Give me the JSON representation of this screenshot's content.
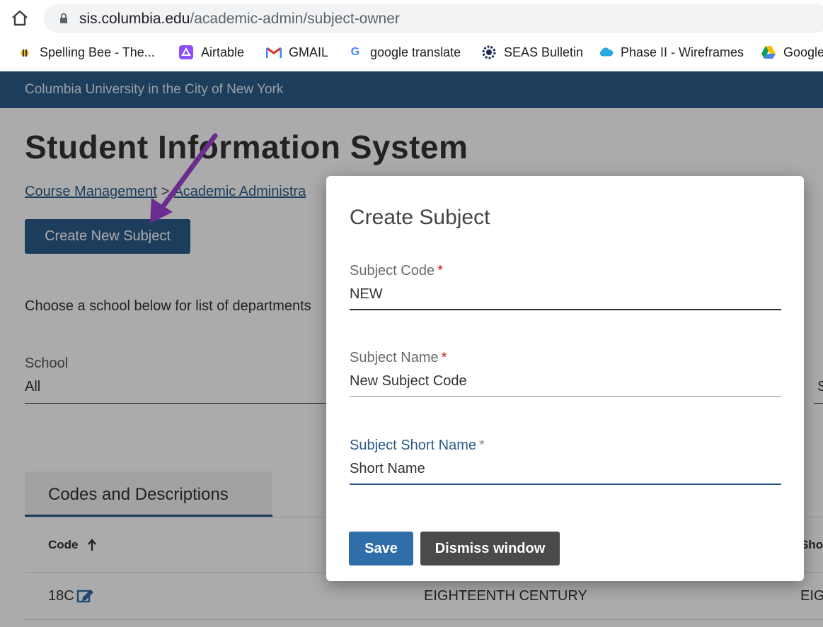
{
  "browser": {
    "url_host": "sis.columbia.edu",
    "url_path": "/academic-admin/subject-owner",
    "bookmarks": [
      {
        "label": "Spelling Bee - The...",
        "icon": "bee-icon"
      },
      {
        "label": "Airtable",
        "icon": "airtable-icon"
      },
      {
        "label": "GMAIL",
        "icon": "gmail-icon"
      },
      {
        "label": "google translate",
        "icon": "google-icon"
      },
      {
        "label": "SEAS Bulletin",
        "icon": "lion-icon"
      },
      {
        "label": "Phase II - Wireframes",
        "icon": "cloud-icon"
      },
      {
        "label": "Google",
        "icon": "drive-icon"
      }
    ]
  },
  "header": {
    "university": "Columbia University in the City of New York"
  },
  "page": {
    "title": "Student Information System",
    "breadcrumbs": [
      "Course Management",
      ">",
      "Academic Administra"
    ],
    "create_button": "Create New Subject",
    "choose_text": "Choose a school below for list of departments",
    "school_label": "School",
    "school_value": "All",
    "side_truncated": "S",
    "tab_label": "Codes and Descriptions",
    "table": {
      "col_code": "Code",
      "col_short": "Sho",
      "rows": [
        {
          "code": "18C",
          "description": "EIGHTEENTH CENTURY",
          "short": "EIG"
        }
      ]
    }
  },
  "modal": {
    "title": "Create Subject",
    "fields": [
      {
        "label": "Subject Code",
        "required_mark": "*",
        "value": "NEW"
      },
      {
        "label": "Subject Name",
        "required_mark": "*",
        "value": "New Subject Code"
      },
      {
        "label": "Subject Short Name",
        "required_mark": "*",
        "value": "Short Name"
      }
    ],
    "save_label": "Save",
    "dismiss_label": "Dismiss window"
  },
  "colors": {
    "brand_blue": "#2a5b8a",
    "arrow_purple": "#6a2c8e",
    "required_red": "#cc2222"
  }
}
